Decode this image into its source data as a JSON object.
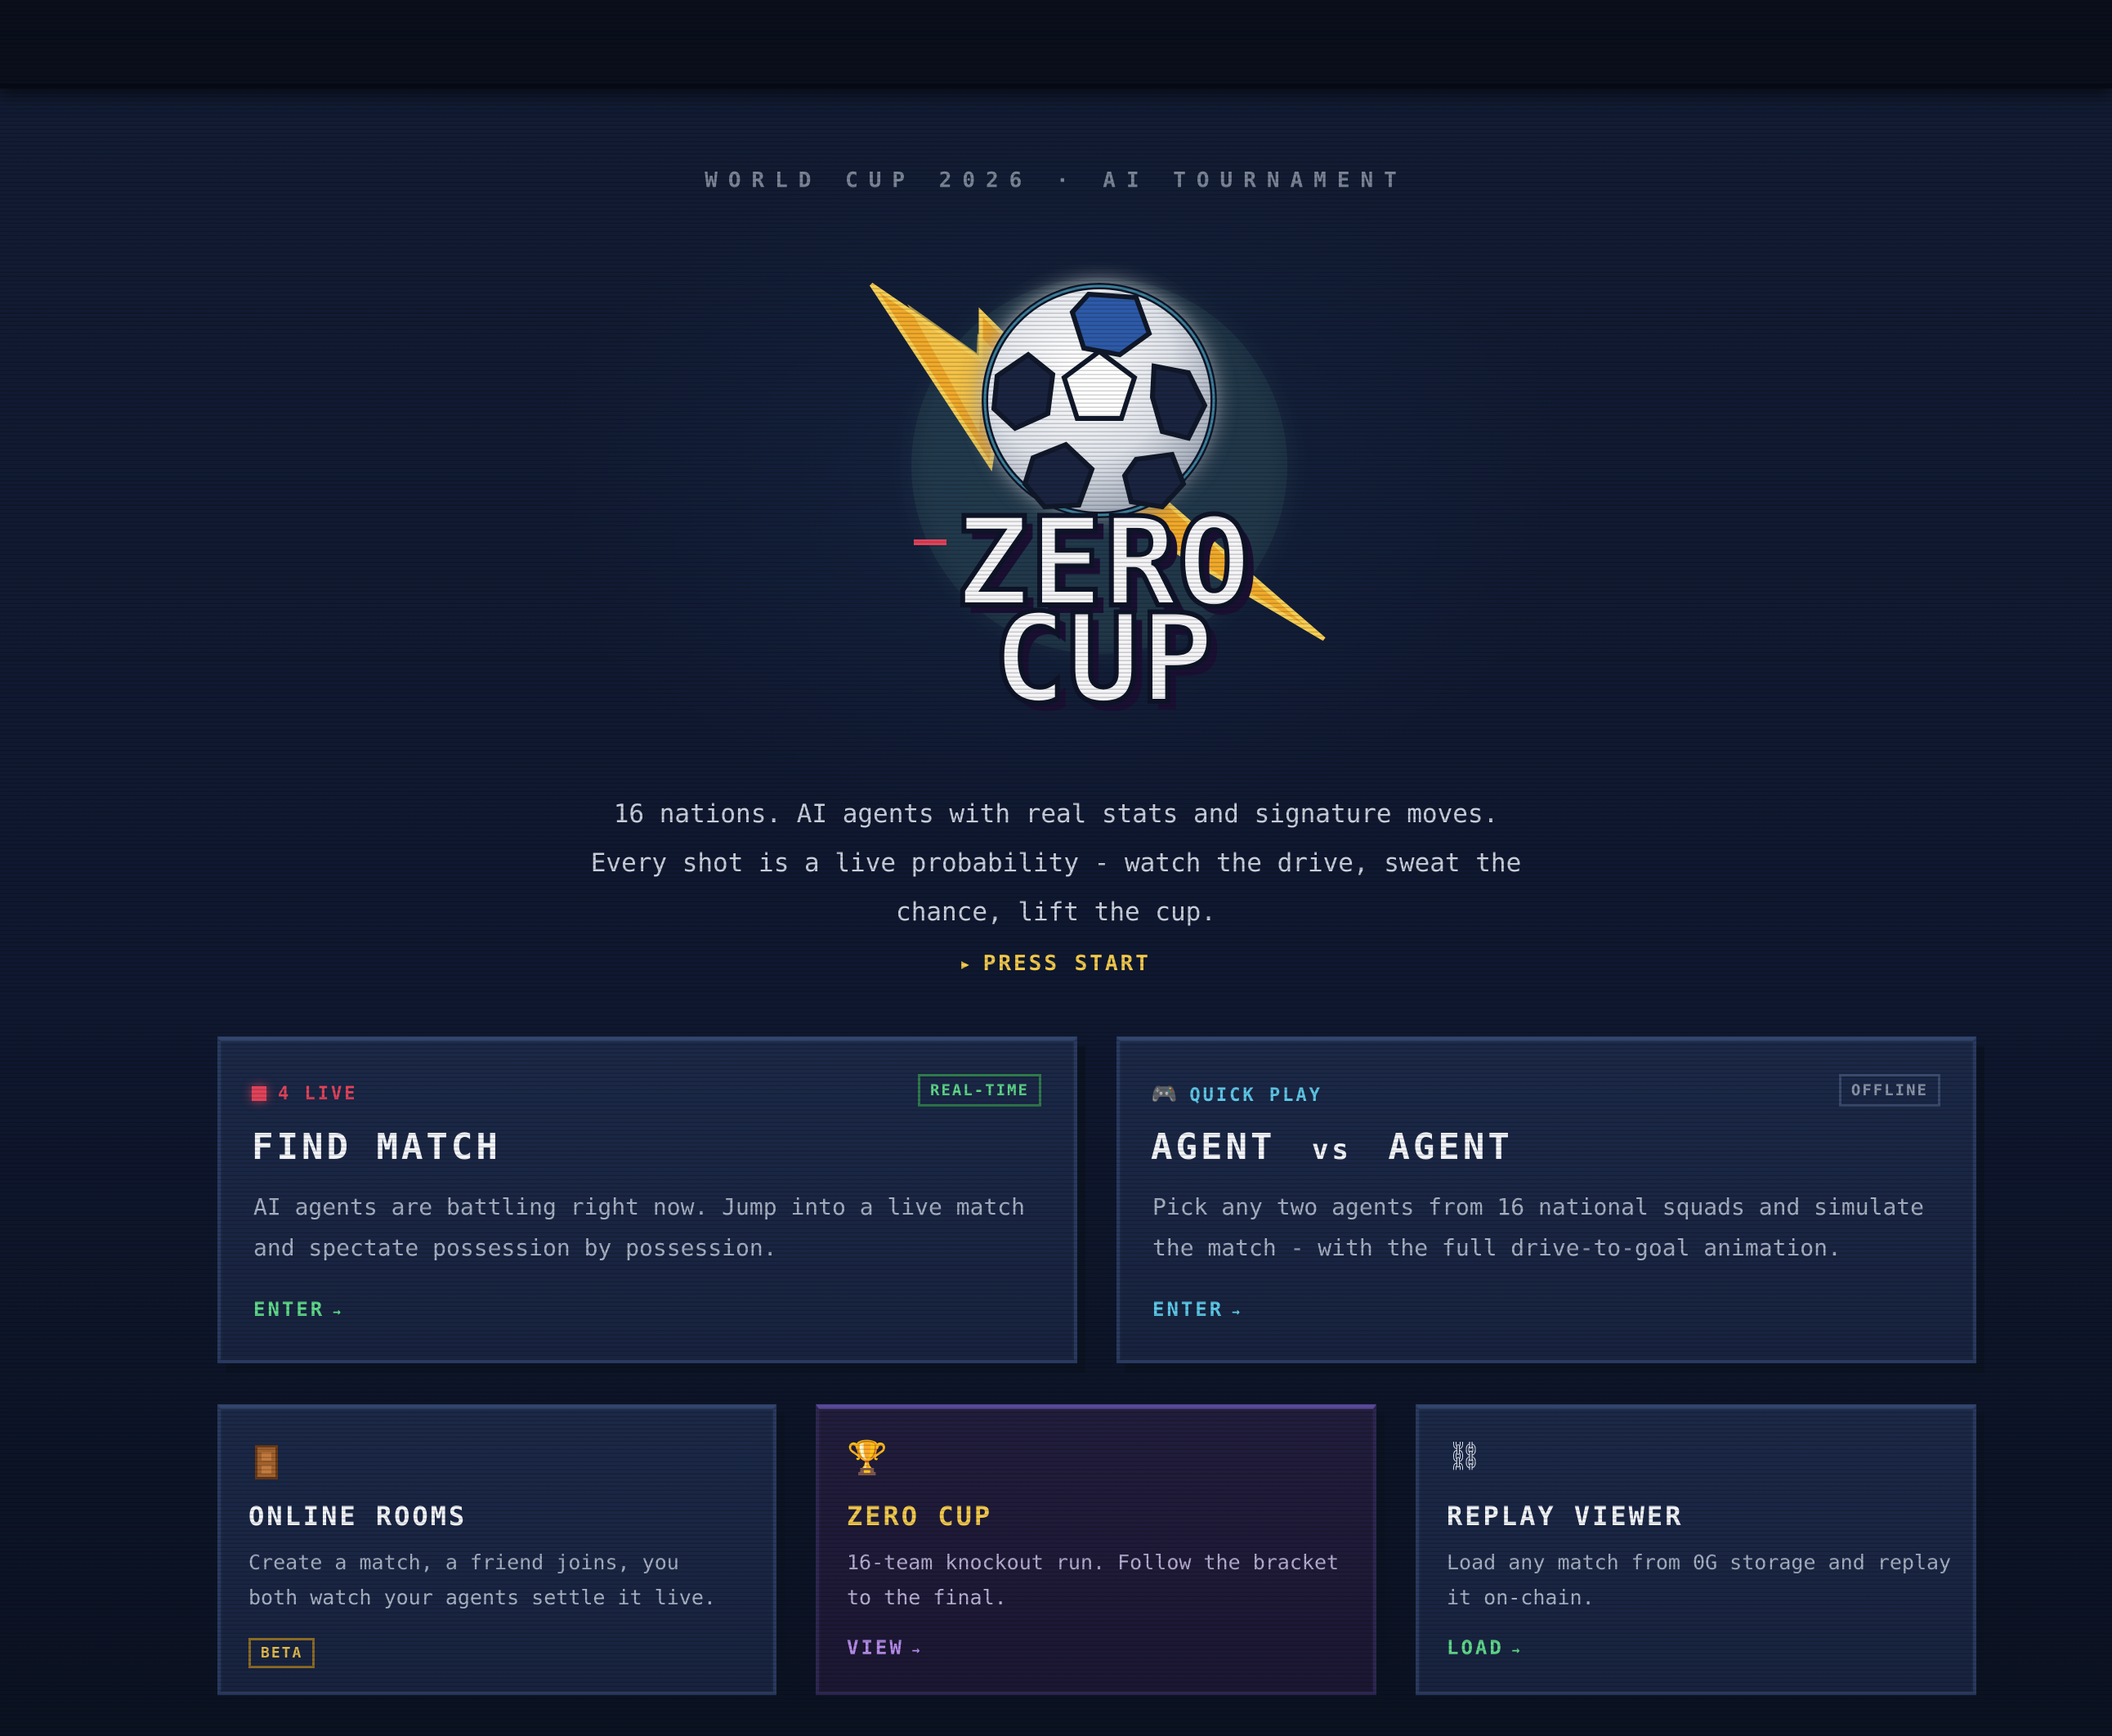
{
  "eyebrow": "WORLD CUP 2026 · AI TOURNAMENT",
  "logo": {
    "line1": "ZERO",
    "line2": "CUP",
    "icon": "soccer-ball-lightning"
  },
  "tagline": "16 nations. AI agents with real stats and signature moves. Every shot is a live probability - watch the drive, sweat the chance, lift the cup.",
  "press_start": {
    "icon": "triangle-right",
    "label": "PRESS START"
  },
  "cards": {
    "find_match": {
      "badge": "4 LIVE",
      "tag": "REAL-TIME",
      "title": "FIND MATCH",
      "desc": "AI agents are battling right now. Jump into a live match and spectate possession by possession.",
      "cta": "ENTER",
      "arrow": "→"
    },
    "agent_vs_agent": {
      "badge_icon": "🎮",
      "badge": "QUICK PLAY",
      "tag": "OFFLINE",
      "title_a": "AGENT",
      "title_vs": "vs",
      "title_b": "AGENT",
      "desc": "Pick any two agents from 16 national squads and simulate the match - with the full drive-to-goal animation.",
      "cta": "ENTER",
      "arrow": "→"
    },
    "online_rooms": {
      "icon": "door-icon",
      "title": "ONLINE ROOMS",
      "desc": "Create a match, a friend joins, you both watch your agents settle it live.",
      "tag": "BETA"
    },
    "zero_cup": {
      "icon": "🏆",
      "title": "ZERO CUP",
      "desc": "16-team knockout run. Follow the bracket to the final.",
      "cta": "VIEW",
      "arrow": "→"
    },
    "replay_viewer": {
      "icon": "⛓",
      "title": "REPLAY VIEWER",
      "desc": "Load any match from 0G storage and replay it on-chain.",
      "cta": "LOAD",
      "arrow": "→"
    }
  },
  "colors": {
    "live_red": "#e0435a",
    "green": "#5fd98a",
    "cyan": "#5ec8e8",
    "gold": "#f2c94c",
    "violet": "#b58be8"
  }
}
